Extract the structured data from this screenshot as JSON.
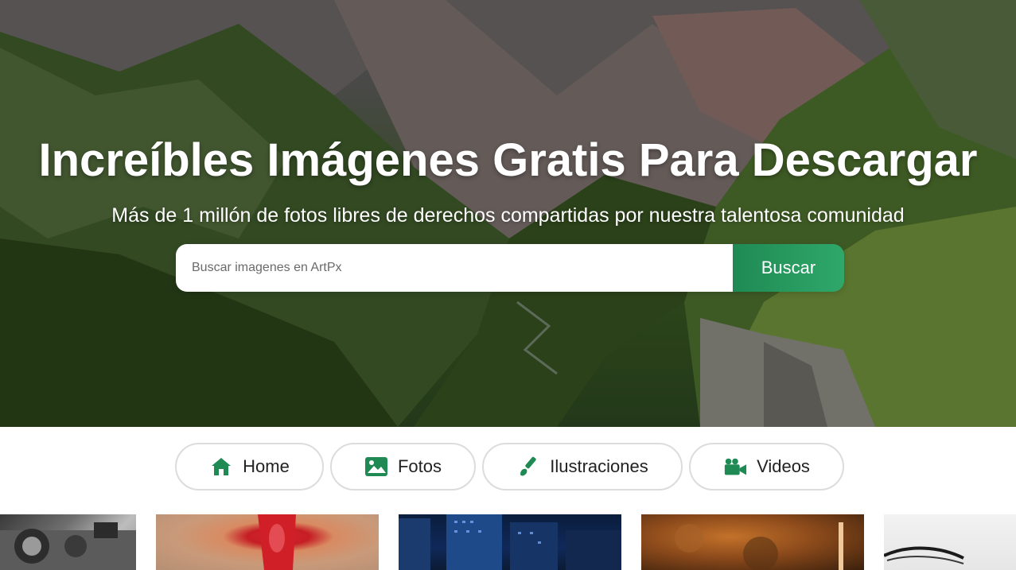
{
  "hero": {
    "title": "Increíbles Imágenes Gratis Para Descargar",
    "subtitle": "Más de 1 millón de fotos libres de derechos compartidas por nuestra talentosa comunidad"
  },
  "search": {
    "placeholder": "Buscar imagenes en ArtPx",
    "button_label": "Buscar"
  },
  "nav": {
    "items": [
      {
        "label": "Home",
        "icon": "home-icon"
      },
      {
        "label": "Fotos",
        "icon": "image-icon"
      },
      {
        "label": "Ilustraciones",
        "icon": "brush-icon"
      },
      {
        "label": "Videos",
        "icon": "video-camera-icon"
      }
    ]
  },
  "colors": {
    "accent": "#1f8a54",
    "accent_light": "#2fa86a",
    "pill_border": "#dcdcdc",
    "text": "#222222"
  }
}
